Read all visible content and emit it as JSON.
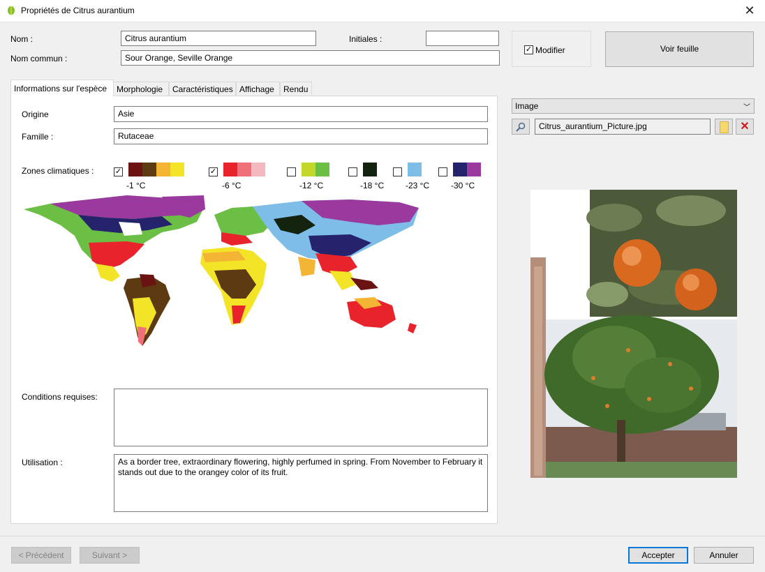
{
  "window": {
    "title": "Propriétés de Citrus aurantium"
  },
  "header": {
    "nom_label": "Nom :",
    "nom_value": "Citrus aurantium",
    "nom_commun_label": "Nom commun :",
    "nom_commun_value": "Sour Orange, Seville Orange",
    "initiales_label": "Initiales :",
    "initiales_value": "",
    "modifier_label": "Modifier",
    "modifier_checked": true,
    "voir_feuille_label": "Voir feuille"
  },
  "tabs": [
    {
      "label": "Informations sur l'espèce",
      "active": true
    },
    {
      "label": "Morphologie"
    },
    {
      "label": "Caractéristiques"
    },
    {
      "label": "Affichage"
    },
    {
      "label": "Rendu"
    }
  ],
  "info": {
    "origine_label": "Origine",
    "origine_value": "Asie",
    "famille_label": "Famille :",
    "famille_value": "Rutaceae",
    "zones_label": "Zones climatiques :",
    "zones": [
      {
        "temp": "-1 °C",
        "checked": true,
        "colors": [
          "#6b1212",
          "#5e3a12",
          "#f3b533",
          "#f3e428"
        ]
      },
      {
        "temp": "-6 °C",
        "checked": true,
        "colors": [
          "#e8232b",
          "#f0707a",
          "#f5b8bf"
        ]
      },
      {
        "temp": "-12 °C",
        "checked": false,
        "colors": [
          "#c4d82c",
          "#6cbf45"
        ]
      },
      {
        "temp": "-18 °C",
        "checked": false,
        "colors": [
          "#13230d"
        ]
      },
      {
        "temp": "-23 °C",
        "checked": false,
        "colors": [
          "#7dbde8"
        ]
      },
      {
        "temp": "-30 °C",
        "checked": false,
        "colors": [
          "#24236c",
          "#9a3a9e"
        ]
      }
    ],
    "conditions_label": "Conditions requises:",
    "conditions_value": "",
    "utilisation_label": "Utilisation :",
    "utilisation_value": "As a border tree, extraordinary flowering, highly perfumed in spring. From November to February it stands out due to the orangey color of its fruit."
  },
  "image_panel": {
    "combo_value": "Image",
    "file_name": "Citrus_aurantium_Picture.jpg"
  },
  "footer": {
    "prev_label": "< Précédent",
    "next_label": "Suivant >",
    "accept_label": "Accepter",
    "cancel_label": "Annuler"
  },
  "colors": {
    "accent": "#0078d7",
    "delete_red": "#d01818"
  }
}
